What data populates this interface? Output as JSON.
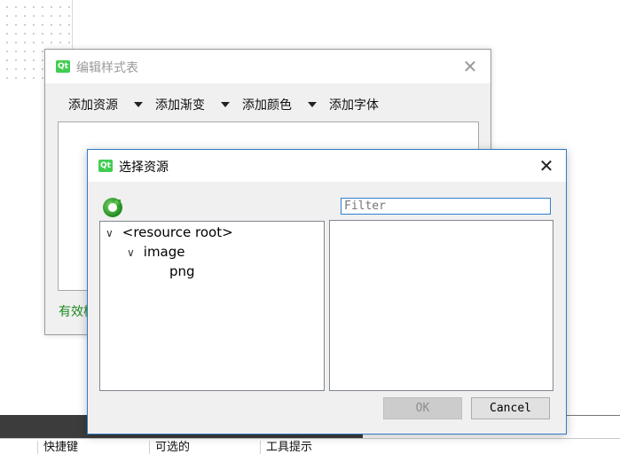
{
  "back_dialog": {
    "title": "编辑样式表",
    "toolbar": [
      "添加资源",
      "添加渐变",
      "添加颜色",
      "添加字体"
    ],
    "status": "有效样式表"
  },
  "front_dialog": {
    "title": "选择资源",
    "filter_placeholder": "Filter",
    "tree": {
      "root": "<resource root>",
      "child": "image",
      "grandchild": "png"
    },
    "ok_label": "OK",
    "cancel_label": "Cancel"
  },
  "background_table": {
    "headers": [
      "快捷键",
      "可选的",
      "工具提示"
    ]
  },
  "icons": {
    "app": "qt-logo-icon",
    "close": "close-icon",
    "reload": "reload-icon",
    "expand": "chevron-down-icon",
    "dropdown": "caret-down-icon"
  },
  "colors": {
    "accent": "#2e7bc6",
    "valid_text": "#1e8a1e",
    "qt_green": "#41cd52"
  }
}
